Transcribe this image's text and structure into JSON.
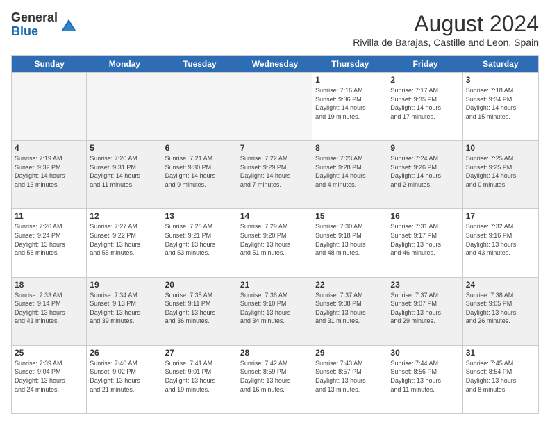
{
  "header": {
    "logo_general": "General",
    "logo_blue": "Blue",
    "month_year": "August 2024",
    "location": "Rivilla de Barajas, Castille and Leon, Spain"
  },
  "days_of_week": [
    "Sunday",
    "Monday",
    "Tuesday",
    "Wednesday",
    "Thursday",
    "Friday",
    "Saturday"
  ],
  "weeks": [
    {
      "cells": [
        {
          "day": "",
          "info": "",
          "empty": true
        },
        {
          "day": "",
          "info": "",
          "empty": true
        },
        {
          "day": "",
          "info": "",
          "empty": true
        },
        {
          "day": "",
          "info": "",
          "empty": true
        },
        {
          "day": "1",
          "info": "Sunrise: 7:16 AM\nSunset: 9:36 PM\nDaylight: 14 hours\nand 19 minutes."
        },
        {
          "day": "2",
          "info": "Sunrise: 7:17 AM\nSunset: 9:35 PM\nDaylight: 14 hours\nand 17 minutes."
        },
        {
          "day": "3",
          "info": "Sunrise: 7:18 AM\nSunset: 9:34 PM\nDaylight: 14 hours\nand 15 minutes."
        }
      ]
    },
    {
      "cells": [
        {
          "day": "4",
          "info": "Sunrise: 7:19 AM\nSunset: 9:32 PM\nDaylight: 14 hours\nand 13 minutes."
        },
        {
          "day": "5",
          "info": "Sunrise: 7:20 AM\nSunset: 9:31 PM\nDaylight: 14 hours\nand 11 minutes."
        },
        {
          "day": "6",
          "info": "Sunrise: 7:21 AM\nSunset: 9:30 PM\nDaylight: 14 hours\nand 9 minutes."
        },
        {
          "day": "7",
          "info": "Sunrise: 7:22 AM\nSunset: 9:29 PM\nDaylight: 14 hours\nand 7 minutes."
        },
        {
          "day": "8",
          "info": "Sunrise: 7:23 AM\nSunset: 9:28 PM\nDaylight: 14 hours\nand 4 minutes."
        },
        {
          "day": "9",
          "info": "Sunrise: 7:24 AM\nSunset: 9:26 PM\nDaylight: 14 hours\nand 2 minutes."
        },
        {
          "day": "10",
          "info": "Sunrise: 7:25 AM\nSunset: 9:25 PM\nDaylight: 14 hours\nand 0 minutes."
        }
      ]
    },
    {
      "cells": [
        {
          "day": "11",
          "info": "Sunrise: 7:26 AM\nSunset: 9:24 PM\nDaylight: 13 hours\nand 58 minutes."
        },
        {
          "day": "12",
          "info": "Sunrise: 7:27 AM\nSunset: 9:22 PM\nDaylight: 13 hours\nand 55 minutes."
        },
        {
          "day": "13",
          "info": "Sunrise: 7:28 AM\nSunset: 9:21 PM\nDaylight: 13 hours\nand 53 minutes."
        },
        {
          "day": "14",
          "info": "Sunrise: 7:29 AM\nSunset: 9:20 PM\nDaylight: 13 hours\nand 51 minutes."
        },
        {
          "day": "15",
          "info": "Sunrise: 7:30 AM\nSunset: 9:18 PM\nDaylight: 13 hours\nand 48 minutes."
        },
        {
          "day": "16",
          "info": "Sunrise: 7:31 AM\nSunset: 9:17 PM\nDaylight: 13 hours\nand 46 minutes."
        },
        {
          "day": "17",
          "info": "Sunrise: 7:32 AM\nSunset: 9:16 PM\nDaylight: 13 hours\nand 43 minutes."
        }
      ]
    },
    {
      "cells": [
        {
          "day": "18",
          "info": "Sunrise: 7:33 AM\nSunset: 9:14 PM\nDaylight: 13 hours\nand 41 minutes."
        },
        {
          "day": "19",
          "info": "Sunrise: 7:34 AM\nSunset: 9:13 PM\nDaylight: 13 hours\nand 39 minutes."
        },
        {
          "day": "20",
          "info": "Sunrise: 7:35 AM\nSunset: 9:11 PM\nDaylight: 13 hours\nand 36 minutes."
        },
        {
          "day": "21",
          "info": "Sunrise: 7:36 AM\nSunset: 9:10 PM\nDaylight: 13 hours\nand 34 minutes."
        },
        {
          "day": "22",
          "info": "Sunrise: 7:37 AM\nSunset: 9:08 PM\nDaylight: 13 hours\nand 31 minutes."
        },
        {
          "day": "23",
          "info": "Sunrise: 7:37 AM\nSunset: 9:07 PM\nDaylight: 13 hours\nand 29 minutes."
        },
        {
          "day": "24",
          "info": "Sunrise: 7:38 AM\nSunset: 9:05 PM\nDaylight: 13 hours\nand 26 minutes."
        }
      ]
    },
    {
      "cells": [
        {
          "day": "25",
          "info": "Sunrise: 7:39 AM\nSunset: 9:04 PM\nDaylight: 13 hours\nand 24 minutes."
        },
        {
          "day": "26",
          "info": "Sunrise: 7:40 AM\nSunset: 9:02 PM\nDaylight: 13 hours\nand 21 minutes."
        },
        {
          "day": "27",
          "info": "Sunrise: 7:41 AM\nSunset: 9:01 PM\nDaylight: 13 hours\nand 19 minutes."
        },
        {
          "day": "28",
          "info": "Sunrise: 7:42 AM\nSunset: 8:59 PM\nDaylight: 13 hours\nand 16 minutes."
        },
        {
          "day": "29",
          "info": "Sunrise: 7:43 AM\nSunset: 8:57 PM\nDaylight: 13 hours\nand 13 minutes."
        },
        {
          "day": "30",
          "info": "Sunrise: 7:44 AM\nSunset: 8:56 PM\nDaylight: 13 hours\nand 11 minutes."
        },
        {
          "day": "31",
          "info": "Sunrise: 7:45 AM\nSunset: 8:54 PM\nDaylight: 13 hours\nand 8 minutes."
        }
      ]
    }
  ]
}
